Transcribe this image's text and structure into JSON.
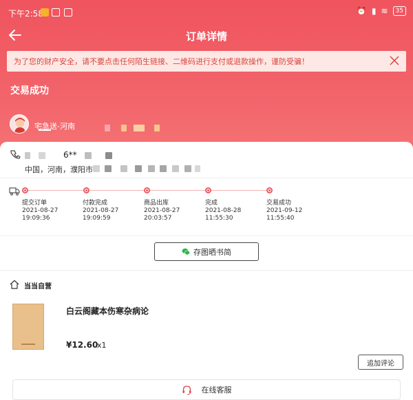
{
  "status_bar": {
    "time": "下午2:58",
    "battery": "35",
    "icons": [
      "app-notification-icon",
      "alarm-icon",
      "signal-icon",
      "wifi-icon",
      "battery-icon"
    ]
  },
  "header": {
    "title": "订单详情",
    "back_icon": "back-arrow-icon"
  },
  "banner": {
    "text": "为了您的财产安全，请不要点击任何陌生链接、二维码进行支付或退款操作，谨防受骗！",
    "close_icon": "close-icon"
  },
  "order_status": "交易成功",
  "courier": {
    "name": "宅急送-河南"
  },
  "address": {
    "phone_fragment": "6**",
    "location": "中国，河南，濮阳市"
  },
  "timeline": [
    {
      "label": "提交订单",
      "date": "2021-08-27",
      "time": "19:09:36"
    },
    {
      "label": "付款完成",
      "date": "2021-08-27",
      "time": "19:09:59"
    },
    {
      "label": "商品出库",
      "date": "2021-08-27",
      "time": "20:03:57"
    },
    {
      "label": "完成",
      "date": "2021-08-28",
      "time": "11:55:30"
    },
    {
      "label": "交易成功",
      "date": "2021-09-12",
      "time": "11:55:40"
    }
  ],
  "share_button": "存图晒书简",
  "shop": {
    "name": "当当自营"
  },
  "product": {
    "title": "白云阁藏本伤寒杂病论",
    "price": "¥12.60",
    "quantity": "x1"
  },
  "review_button": "追加评论",
  "service_button": "在线客服",
  "colors": {
    "accent": "#f0545e",
    "banner_bg": "#fde8e5",
    "banner_text": "#d8443d",
    "timeline_dot": "#ec5c62"
  }
}
